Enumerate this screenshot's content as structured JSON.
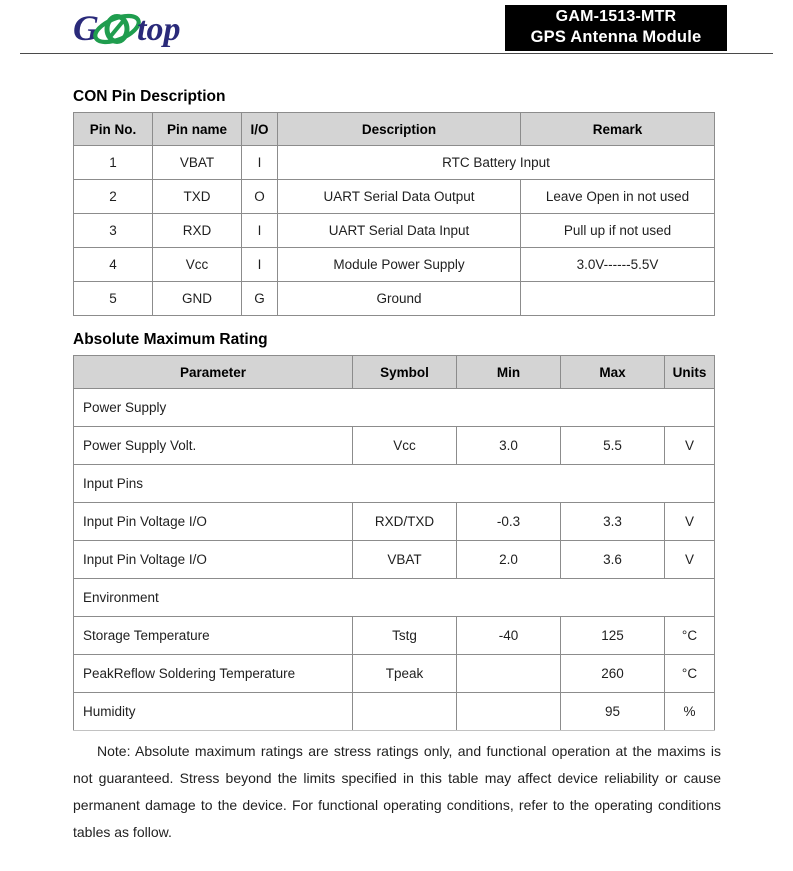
{
  "header": {
    "logo_text_1": "G",
    "logo_text_2": "O",
    "logo_text_3": "top",
    "logo_alt": "Gotop",
    "badge_line1": "GAM-1513-MTR",
    "badge_line2": "GPS Antenna Module",
    "colors": {
      "logo_navy": "#2a2a7a",
      "logo_green": "#1f9d4e",
      "badge_bg": "#000000",
      "badge_text": "#ffffff",
      "table_header_bg": "#d4d4d4",
      "table_border": "#8c8c8c"
    }
  },
  "con_pin_description": {
    "title": "CON Pin Description",
    "columns": [
      "Pin No.",
      "Pin name",
      "I/O",
      "Description",
      "Remark"
    ],
    "rows": [
      {
        "pin_no": "1",
        "pin_name": "VBAT",
        "io": "I",
        "description": "RTC Battery Input",
        "remark": "",
        "span_description": true
      },
      {
        "pin_no": "2",
        "pin_name": "TXD",
        "io": "O",
        "description": "UART Serial Data Output",
        "remark": "Leave Open in not used",
        "span_description": false
      },
      {
        "pin_no": "3",
        "pin_name": "RXD",
        "io": "I",
        "description": "UART Serial Data Input",
        "remark": "Pull up if not used",
        "span_description": false
      },
      {
        "pin_no": "4",
        "pin_name": "Vcc",
        "io": "I",
        "description": "Module Power Supply",
        "remark": "3.0V------5.5V",
        "span_description": false
      },
      {
        "pin_no": "5",
        "pin_name": "GND",
        "io": "G",
        "description": "Ground",
        "remark": "",
        "span_description": false
      }
    ]
  },
  "absolute_maximum_rating": {
    "title": "Absolute Maximum Rating",
    "columns": [
      "Parameter",
      "Symbol",
      "Min",
      "Max",
      "Units"
    ],
    "rows": [
      {
        "type": "section",
        "parameter": "Power Supply"
      },
      {
        "type": "data",
        "parameter": "Power Supply Volt.",
        "symbol": "Vcc",
        "min": "3.0",
        "max": "5.5",
        "units": "V"
      },
      {
        "type": "section",
        "parameter": "Input Pins"
      },
      {
        "type": "data",
        "parameter": "Input Pin Voltage I/O",
        "symbol": "RXD/TXD",
        "min": "-0.3",
        "max": "3.3",
        "units": "V"
      },
      {
        "type": "data",
        "parameter": "Input Pin Voltage I/O",
        "symbol": "VBAT",
        "min": "2.0",
        "max": "3.6",
        "units": "V"
      },
      {
        "type": "section",
        "parameter": "Environment"
      },
      {
        "type": "data",
        "parameter": "Storage Temperature",
        "symbol": "Tstg",
        "min": "-40",
        "max": "125",
        "units": "°C"
      },
      {
        "type": "data",
        "parameter": "PeakReflow Soldering Temperature",
        "symbol": "Tpeak",
        "min": "",
        "max": "260",
        "units": "°C"
      },
      {
        "type": "data",
        "parameter": "Humidity",
        "symbol": "",
        "min": "",
        "max": "95",
        "units": "%"
      }
    ]
  },
  "note": {
    "text": "Note: Absolute maximum ratings are stress ratings only, and functional operation at the maxims is not guaranteed. Stress beyond the limits specified in this table may affect device reliability or cause permanent damage to the device. For functional operating conditions, refer to the operating conditions tables as follow."
  }
}
